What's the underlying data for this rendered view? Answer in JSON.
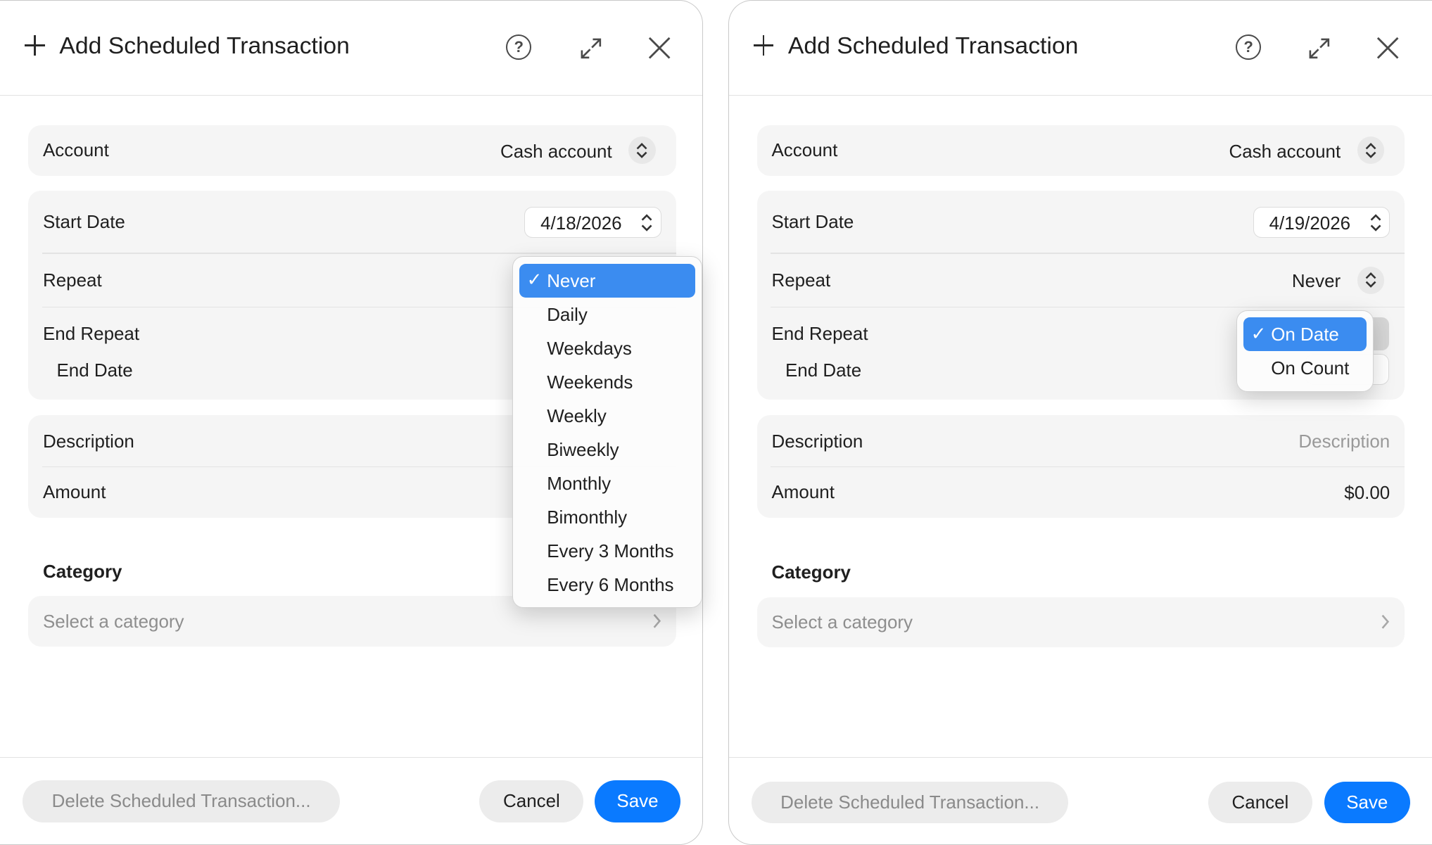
{
  "left": {
    "title": "Add Scheduled Transaction",
    "account_label": "Account",
    "account_value": "Cash account",
    "start_date_label": "Start Date",
    "start_date_value": "4/18/2026",
    "repeat_label": "Repeat",
    "end_repeat_label": "End Repeat",
    "end_date_label": "End Date",
    "description_label": "Description",
    "amount_label": "Amount",
    "category_title": "Category",
    "category_placeholder": "Select a category",
    "delete_label": "Delete Scheduled Transaction...",
    "cancel_label": "Cancel",
    "save_label": "Save",
    "repeat_menu": {
      "checkmark": "✓",
      "selected": "Never",
      "items": [
        "Never",
        "Daily",
        "Weekdays",
        "Weekends",
        "Weekly",
        "Biweekly",
        "Monthly",
        "Bimonthly",
        "Every 3 Months",
        "Every 6 Months"
      ]
    }
  },
  "right": {
    "title": "Add Scheduled Transaction",
    "account_label": "Account",
    "account_value": "Cash account",
    "start_date_label": "Start Date",
    "start_date_value": "4/19/2026",
    "repeat_label": "Repeat",
    "repeat_value": "Never",
    "end_repeat_label": "End Repeat",
    "end_date_label": "End Date",
    "description_label": "Description",
    "description_placeholder": "Description",
    "amount_label": "Amount",
    "amount_value": "$0.00",
    "category_title": "Category",
    "category_placeholder": "Select a category",
    "delete_label": "Delete Scheduled Transaction...",
    "cancel_label": "Cancel",
    "save_label": "Save",
    "end_repeat_menu": {
      "checkmark": "✓",
      "selected": "On Date",
      "items": [
        "On Date",
        "On Count"
      ]
    }
  },
  "colors": {
    "accent": "#0a7aff",
    "menu_selection": "#3b8cf0",
    "card_bg": "#f5f5f5"
  }
}
